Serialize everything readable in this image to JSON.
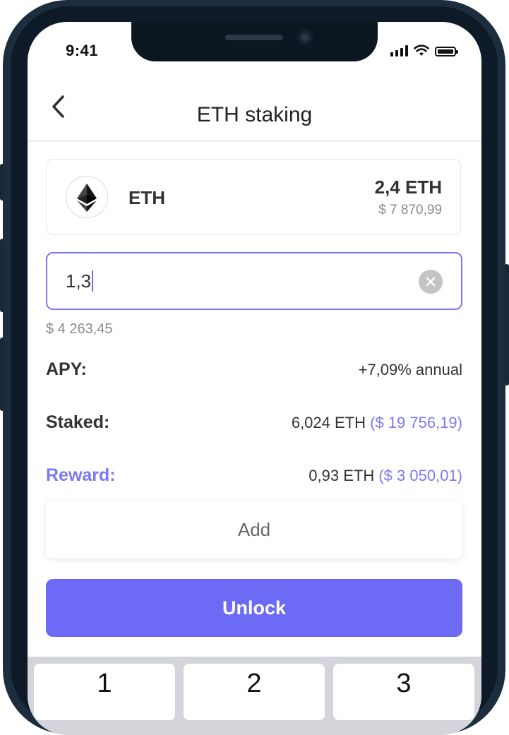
{
  "status_bar": {
    "time": "9:41",
    "icons": [
      "cellular-signal-icon",
      "wifi-icon",
      "battery-icon"
    ]
  },
  "nav": {
    "back_icon": "chevron-left-icon",
    "title": "ETH staking"
  },
  "asset": {
    "icon": "ethereum-icon",
    "symbol": "ETH",
    "balance": "2,4 ETH",
    "balance_fiat": "$ 7 870,99"
  },
  "amount_input": {
    "value": "1,3",
    "clear_icon": "clear-x-icon",
    "fiat_value": "$ 4 263,45"
  },
  "details": {
    "apy": {
      "label": "APY:",
      "value": "+7,09% annual"
    },
    "staked": {
      "label": "Staked:",
      "value": "6,024 ETH",
      "fiat": "($ 19 756,19)"
    },
    "reward": {
      "label": "Reward:",
      "value": "0,93 ETH",
      "fiat": "($ 3 050,01)"
    }
  },
  "buttons": {
    "add_label": "Add",
    "unlock_label": "Unlock"
  },
  "keypad": {
    "keys": [
      "1",
      "2",
      "3"
    ]
  },
  "colors": {
    "accent": "#6d6af6",
    "frame": "#1c2d3e",
    "muted_text": "#8a8a8f",
    "keypad_bg": "#d3d5db"
  }
}
